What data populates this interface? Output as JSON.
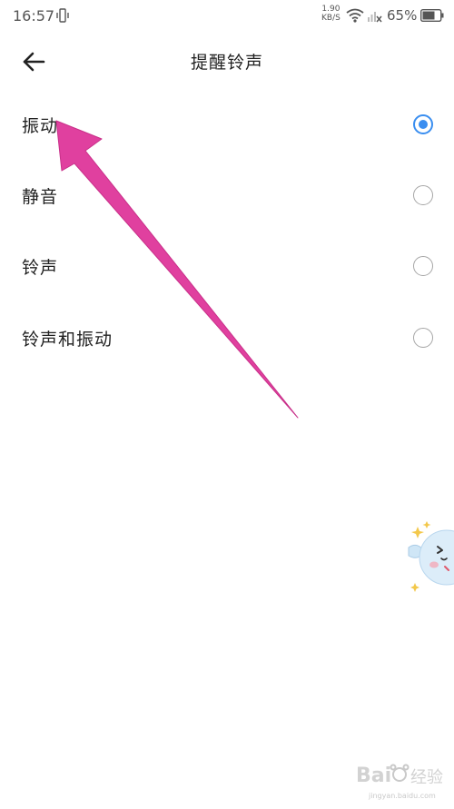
{
  "status_bar": {
    "time": "16:57",
    "net_speed_value": "1.90",
    "net_speed_unit": "KB/S",
    "battery_percent": "65%",
    "icons": [
      "vibrate-icon",
      "wifi-icon",
      "signal-icon",
      "battery-icon"
    ]
  },
  "header": {
    "back_icon": "arrow-left-icon",
    "title": "提醒铃声"
  },
  "options": [
    {
      "label": "振动",
      "selected": true
    },
    {
      "label": "静音",
      "selected": false
    },
    {
      "label": "铃声",
      "selected": false
    },
    {
      "label": "铃声和振动",
      "selected": false
    }
  ],
  "colors": {
    "accent": "#3a8ef0",
    "annotation_arrow": "#e0409f",
    "radio_off": "#a6a6a6"
  },
  "watermark": {
    "text": "Bai 经验",
    "subtext": "jingyan.baidu.com"
  }
}
